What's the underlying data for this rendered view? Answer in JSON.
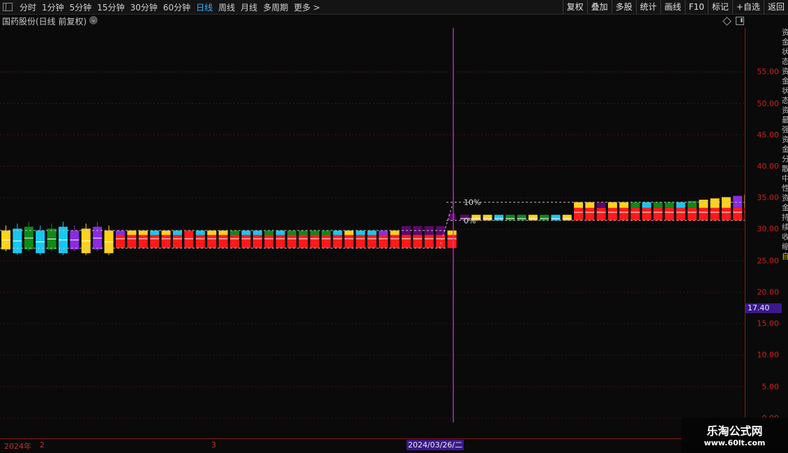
{
  "toolbar": {
    "periods": [
      "分时",
      "1分钟",
      "5分钟",
      "15分钟",
      "30分钟",
      "60分钟",
      "日线",
      "周线",
      "月线",
      "多周期",
      "更多"
    ],
    "active_period": "日线",
    "more_arrow": ">",
    "actions": [
      "复权",
      "叠加",
      "多股",
      "统计",
      "画线",
      "F10",
      "标记",
      "+自选",
      "返回"
    ]
  },
  "stock": {
    "title": "国药股份(日线 前复权)",
    "dropdown_glyph": "⌄"
  },
  "axis": {
    "ticks": [
      "55.00",
      "50.00",
      "45.00",
      "40.00",
      "35.00",
      "30.00",
      "25.00",
      "20.00",
      "15.00",
      "10.00",
      "5.00",
      "0.00"
    ],
    "current_price": "17.40"
  },
  "overlay": {
    "ref_percent_label": "10%",
    "ref_zero_label": "0%"
  },
  "right_strip": [
    "资",
    "金",
    "状",
    "态",
    "资",
    "金",
    "状",
    "态",
    "资",
    "最",
    "强",
    "资",
    "金",
    "分",
    "散",
    "中",
    "性",
    "资",
    "金",
    "持",
    "续",
    "收",
    "缩",
    "自"
  ],
  "footer": {
    "year_label": "2024年",
    "month_2": "2",
    "month_3": "3",
    "cursor_date": "2024/03/26/二"
  },
  "watermark": {
    "title": "乐淘公式网",
    "url": "www.60lt.com"
  },
  "colors": {
    "up_red": "#ff1a1a",
    "yellow": "#ffd21a",
    "cyan": "#16c8f0",
    "purple": "#8a2be2",
    "dark_purple": "#5a0a6a",
    "green": "#0e8a1a",
    "cursor_magenta": "#cc33cc",
    "axis_red": "#d02020"
  },
  "chart_data": {
    "type": "candlestick-band",
    "y_range": [
      -3,
      62
    ],
    "pre_cursor": {
      "count": 40,
      "band_low": 27.0,
      "band_top": 29.8,
      "red_top": 29.4,
      "caps": [
        "yellow",
        "cyan",
        "green",
        "cyan",
        "green",
        "cyan",
        "purple",
        "yellow",
        "purple",
        "yellow",
        "purple",
        "yellow",
        "yellow",
        "cyan",
        "yellow",
        "cyan",
        "red",
        "cyan",
        "yellow",
        "yellow",
        "green",
        "cyan",
        "cyan",
        "green",
        "cyan",
        "green",
        "green",
        "green",
        "green",
        "cyan",
        "yellow",
        "cyan",
        "cyan",
        "purple",
        "yellow",
        "dark_purple",
        "dark_purple",
        "dark_purple",
        "dark_purple",
        "yellow"
      ],
      "full_candles": [
        0,
        1,
        2,
        3,
        4,
        5,
        6,
        7,
        8,
        9
      ]
    },
    "post_cursor": {
      "count": 26,
      "band_low": 31.4,
      "band_top": 34.3,
      "caps": [
        "dark_purple",
        "yellow",
        "yellow",
        "cyan",
        "green",
        "green",
        "yellow",
        "green",
        "cyan",
        "yellow",
        "yellow",
        "yellow",
        "dark_purple",
        "yellow",
        "yellow",
        "green",
        "cyan",
        "green",
        "green",
        "cyan",
        "green",
        "yellow",
        "yellow",
        "yellow",
        "purple",
        "yellow"
      ],
      "rising_start": 10
    },
    "reference_lines": [
      {
        "label": "10%",
        "value": 34.3
      },
      {
        "label": "0%",
        "value": 31.4
      }
    ]
  }
}
